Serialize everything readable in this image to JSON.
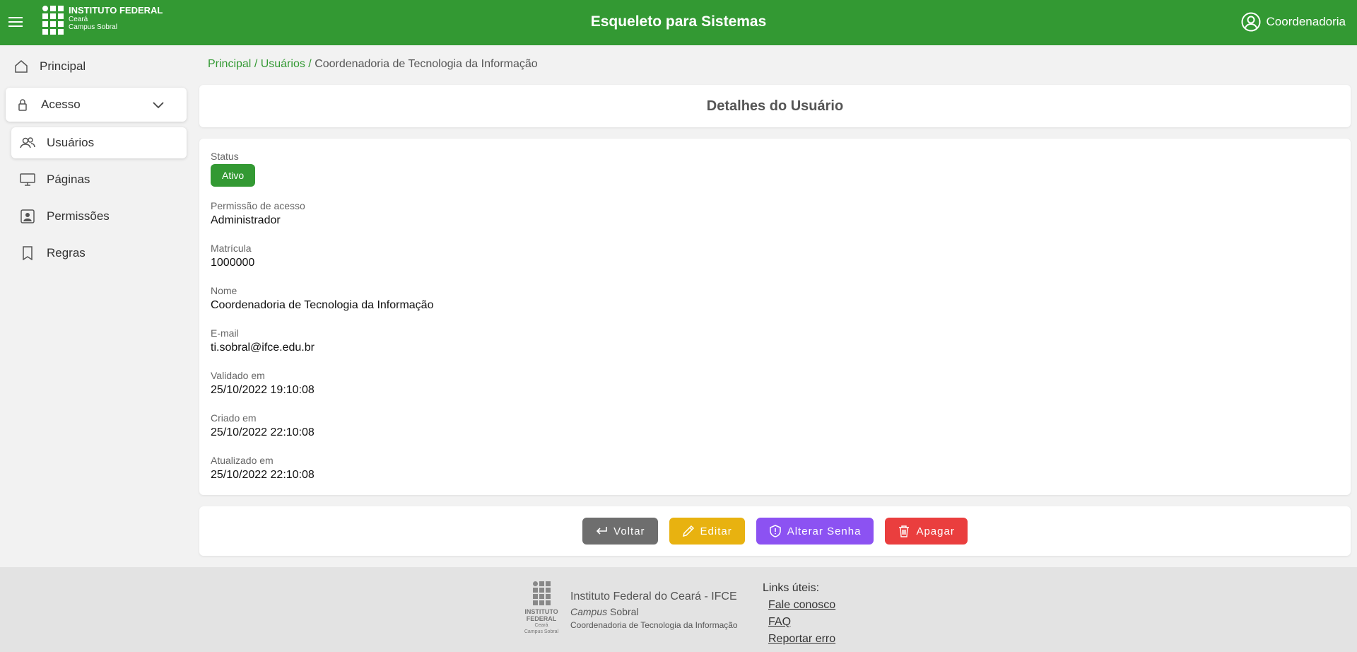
{
  "header": {
    "logo_line1": "INSTITUTO FEDERAL",
    "logo_line2": "Ceará",
    "logo_line3": "Campus Sobral",
    "title": "Esqueleto para Sistemas",
    "user_label": "Coordenadoria"
  },
  "sidebar": {
    "principal": "Principal",
    "acesso": "Acesso",
    "items": [
      {
        "label": "Usuários"
      },
      {
        "label": "Páginas"
      },
      {
        "label": "Permissões"
      },
      {
        "label": "Regras"
      }
    ]
  },
  "breadcrumb": {
    "item1": "Principal",
    "item2": "Usuários",
    "current": "Coordenadoria de Tecnologia da Informação"
  },
  "page_title": "Detalhes do Usuário",
  "details": {
    "status_label": "Status",
    "status_value": "Ativo",
    "permissao_label": "Permissão de acesso",
    "permissao_value": "Administrador",
    "matricula_label": "Matrícula",
    "matricula_value": "1000000",
    "nome_label": "Nome",
    "nome_value": "Coordenadoria de Tecnologia da Informação",
    "email_label": "E-mail",
    "email_value": "ti.sobral@ifce.edu.br",
    "validado_label": "Validado em",
    "validado_value": "25/10/2022 19:10:08",
    "criado_label": "Criado em",
    "criado_value": "25/10/2022 22:10:08",
    "atualizado_label": "Atualizado em",
    "atualizado_value": "25/10/2022 22:10:08"
  },
  "actions": {
    "voltar": "Voltar",
    "editar": "Editar",
    "alterar_senha": "Alterar Senha",
    "apagar": "Apagar"
  },
  "footer": {
    "logo_t1": "INSTITUTO FEDERAL",
    "logo_t2": "Ceará",
    "logo_t3": "Campus Sobral",
    "inst_name": "Instituto Federal do Ceará - IFCE",
    "campus_italic": "Campus",
    "campus_name": "Sobral",
    "dept": "Coordenadoria de Tecnologia da Informação",
    "links_title": "Links úteis:",
    "links": [
      "Fale conosco",
      "FAQ",
      "Reportar erro"
    ]
  },
  "colors": {
    "brand_green": "#339933",
    "btn_gray": "#6e6e6e",
    "btn_yellow": "#e8b210",
    "btn_purple": "#8c52f2",
    "btn_red": "#ea3e3e"
  },
  "icons": [
    "menu-icon",
    "user-circle-icon",
    "home-icon",
    "lock-icon",
    "chevron-down-icon",
    "users-icon",
    "monitor-icon",
    "badge-icon",
    "bookmark-icon",
    "return-icon",
    "pencil-icon",
    "shield-icon",
    "trash-icon"
  ]
}
